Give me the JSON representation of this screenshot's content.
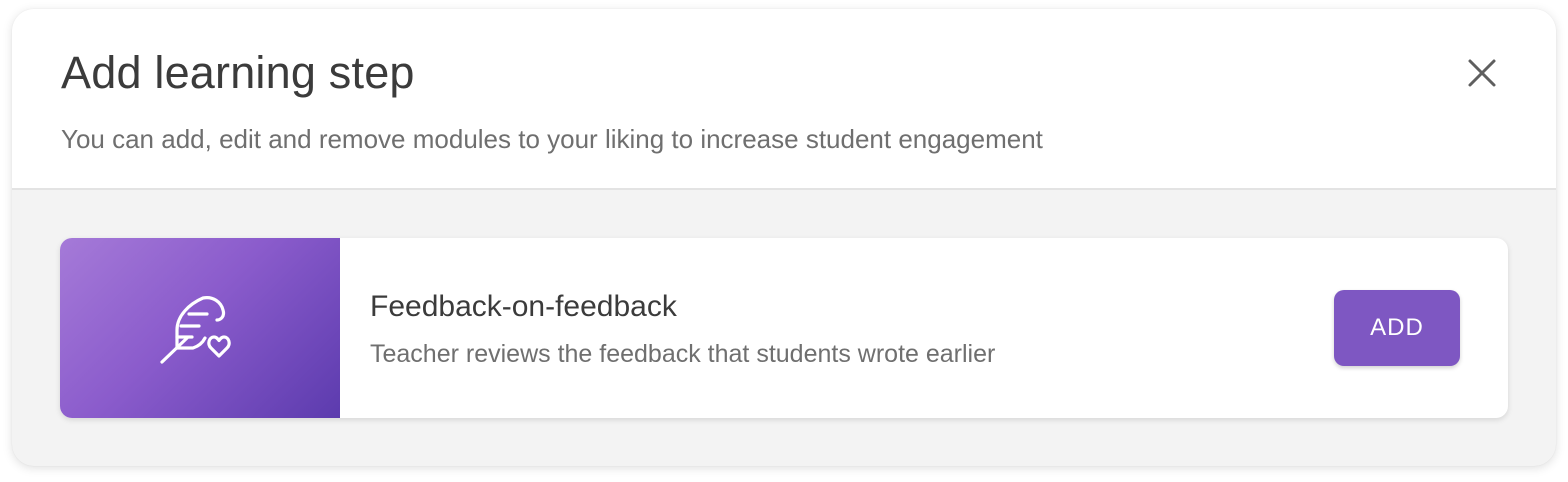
{
  "dialog": {
    "title": "Add learning step",
    "subtitle": "You can add, edit and remove modules to your liking to increase student engagement",
    "close_icon": "close-icon"
  },
  "module": {
    "icon": "feather-heart-icon",
    "title": "Feedback-on-feedback",
    "description": "Teacher reviews the feedback that students wrote earlier",
    "add_label": "ADD",
    "accent_color": "#7e57c2"
  }
}
